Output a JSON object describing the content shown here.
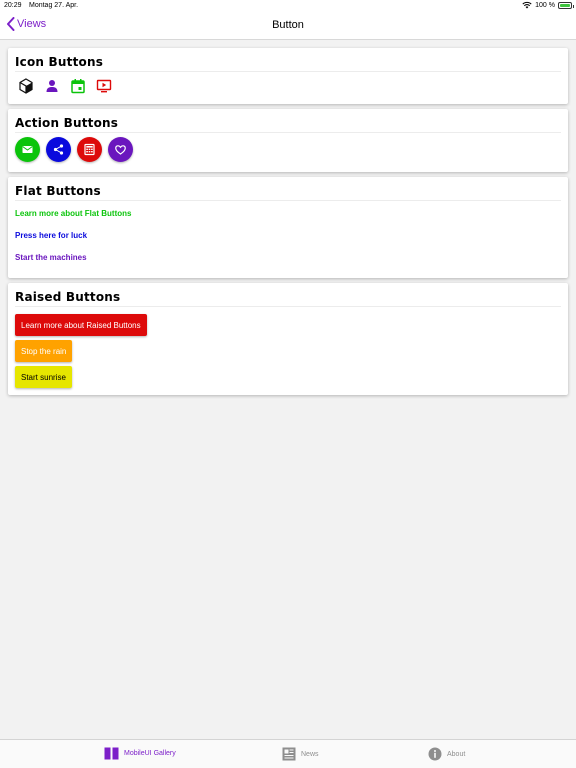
{
  "status_bar": {
    "time": "20:29",
    "date": "Montag 27. Apr.",
    "battery": "100 %"
  },
  "nav": {
    "back_label": "Views",
    "title": "Button"
  },
  "colors": {
    "accent": "#7c1fc9",
    "green": "#0bc40b",
    "blue": "#0a0add",
    "red": "#dd0a0a",
    "purple": "#6a16be",
    "orange": "#ffa200",
    "yellow": "#e6e600"
  },
  "icon_buttons": {
    "title": "Icon Buttons",
    "icons": [
      "cube-icon",
      "person-icon",
      "calendar-icon",
      "tv-play-icon"
    ]
  },
  "action_buttons": {
    "title": "Action Buttons",
    "icons": [
      "mail-icon",
      "share-icon",
      "calculator-icon",
      "heart-icon"
    ]
  },
  "flat_buttons": {
    "title": "Flat Buttons",
    "items": [
      "Learn more about Flat Buttons",
      "Press here for luck",
      "Start the machines"
    ]
  },
  "raised_buttons": {
    "title": "Raised Buttons",
    "items": [
      "Learn more about Raised Buttons",
      "Stop the rain",
      "Start sunrise"
    ]
  },
  "tabs": [
    {
      "label": "MobileUI Gallery",
      "icon": "book-icon",
      "active": true
    },
    {
      "label": "News",
      "icon": "newspaper-icon",
      "active": false
    },
    {
      "label": "About",
      "icon": "info-icon",
      "active": false
    }
  ]
}
